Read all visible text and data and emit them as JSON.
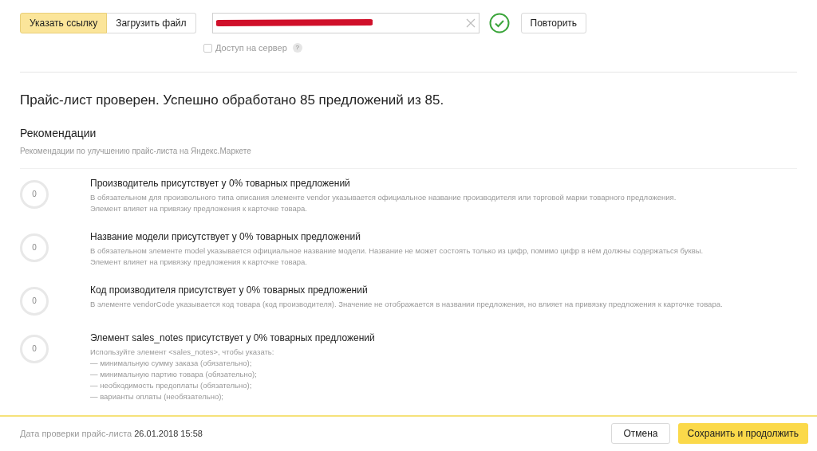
{
  "source_tabs": [
    {
      "label": "Указать ссылку",
      "selected": true
    },
    {
      "label": "Загрузить файл",
      "selected": false
    }
  ],
  "url_field": {
    "redacted": true,
    "valid": true
  },
  "retry_button": "Повторить",
  "server_access": {
    "label": "Доступ на сервер",
    "checked": false,
    "help": "?"
  },
  "result_title": "Прайс-лист проверен. Успешно обработано 85 предложений из 85.",
  "recommendations": {
    "title": "Рекомендации",
    "subtitle": "Рекомендации по улучшению прайс-листа на Яндекс.Маркете",
    "items": [
      {
        "score": "0",
        "title": "Производитель присутствует у 0% товарных предложений",
        "lines": [
          "В обязательном для произвольного типа описания элементе vendor указывается официальное название производителя или торговой марки товарного предложения.",
          "Элемент влияет на привязку предложения к карточке товара."
        ]
      },
      {
        "score": "0",
        "title": "Название модели присутствует у 0% товарных предложений",
        "lines": [
          "В обязательном элементе model указывается официальное название модели. Название не может состоять только из цифр, помимо цифр в нём должны содержаться буквы.",
          "Элемент влияет на привязку предложения к карточке товара."
        ]
      },
      {
        "score": "0",
        "title": "Код производителя присутствует у 0% товарных предложений",
        "lines": [
          "В элементе vendorCode указывается код товара (код производителя). Значение не отображается в названии предложения, но влияет на привязку предложения к карточке товара."
        ]
      },
      {
        "score": "0",
        "title": "Элемент sales_notes присутствует у 0% товарных предложений",
        "lines": [
          "Используйте элемент <sales_notes>, чтобы указать:",
          "— минимальную сумму заказа (обязательно);",
          "— минимальную партию товара (обязательно);",
          "— необходимость предоплаты (обязательно);",
          "— варианты оплаты (необязательно);"
        ]
      }
    ]
  },
  "footer": {
    "date_label": "Дата проверки прайс-листа",
    "date_value": "26.01.2018 15:58",
    "cancel": "Отмена",
    "save": "Сохранить и продолжить"
  }
}
